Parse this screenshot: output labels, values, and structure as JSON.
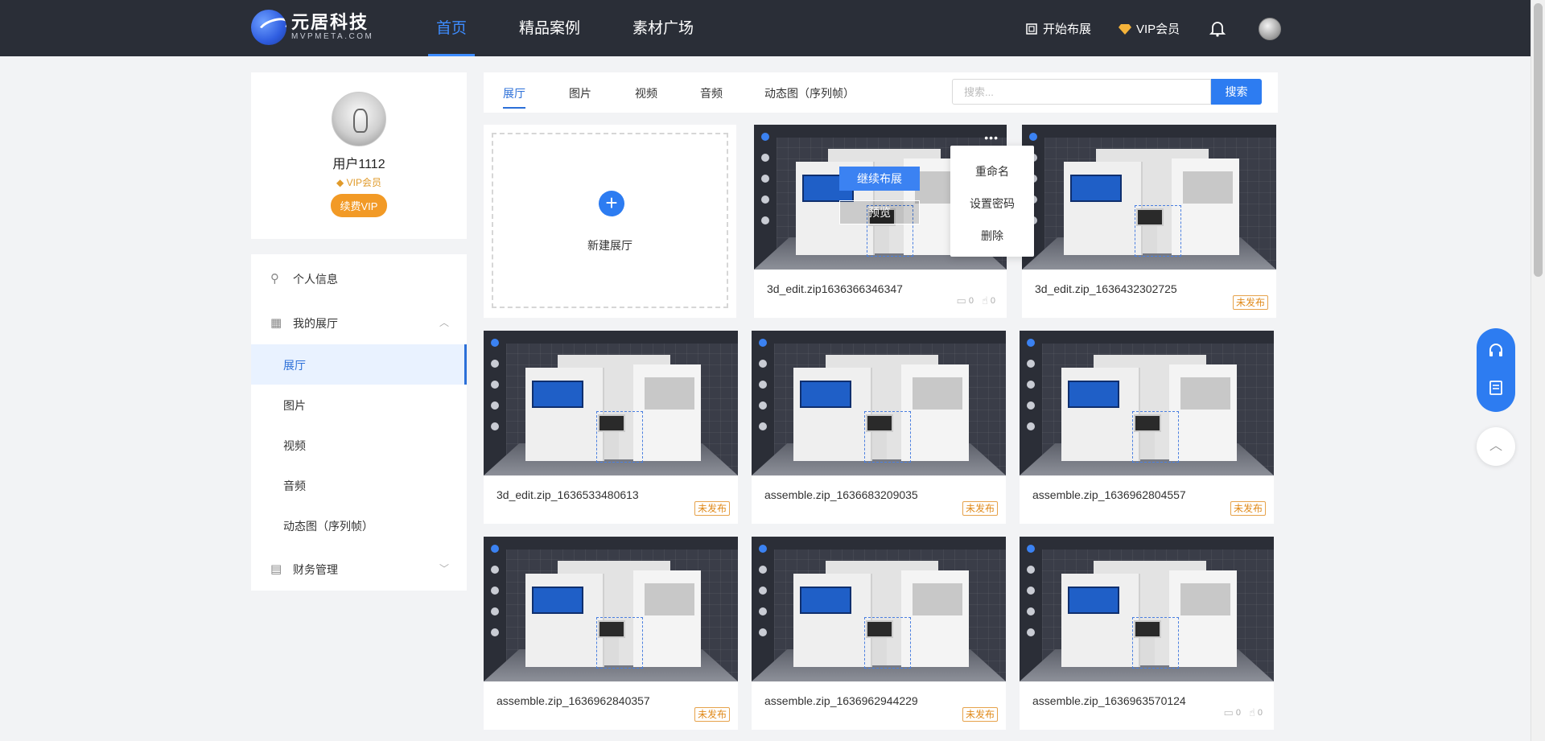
{
  "header": {
    "logo_name": "元居科技",
    "logo_sub": "MVPMETA.COM",
    "nav": [
      "首页",
      "精品案例",
      "素材广场"
    ],
    "start_layout": "开始布展",
    "vip": "VIP会员"
  },
  "profile": {
    "username": "用户1112",
    "vip_label": "VIP会员",
    "renew_button": "续费VIP"
  },
  "menu": {
    "personal_info": "个人信息",
    "my_hall": "我的展厅",
    "sub": [
      "展厅",
      "图片",
      "视频",
      "音频",
      "动态图（序列帧）"
    ],
    "finance": "财务管理"
  },
  "tabs": [
    "展厅",
    "图片",
    "视频",
    "音频",
    "动态图（序列帧）"
  ],
  "search": {
    "placeholder": "搜索...",
    "button": "搜索"
  },
  "new_card": {
    "label": "新建展厅"
  },
  "overlay": {
    "continue": "继续布展",
    "preview": "预览"
  },
  "dropdown": [
    "重命名",
    "设置密码",
    "删除"
  ],
  "cards": [
    {
      "title": "3d_edit.zip1636366346347",
      "comments": "0",
      "likes": "0"
    },
    {
      "title": "3d_edit.zip_1636432302725",
      "badge": "未发布"
    },
    {
      "title": "3d_edit.zip_1636533480613",
      "badge": "未发布"
    },
    {
      "title": "assemble.zip_1636683209035",
      "badge": "未发布"
    },
    {
      "title": "assemble.zip_1636962804557",
      "badge": "未发布"
    },
    {
      "title": "assemble.zip_1636962840357",
      "badge": "未发布"
    },
    {
      "title": "assemble.zip_1636962944229",
      "badge": "未发布"
    },
    {
      "title": "assemble.zip_1636963570124",
      "comments": "0",
      "likes": "0"
    }
  ],
  "colors": {
    "header_bg": "#2a2e37",
    "accent": "#2d7cf1",
    "vip_orange": "#f29a26"
  }
}
